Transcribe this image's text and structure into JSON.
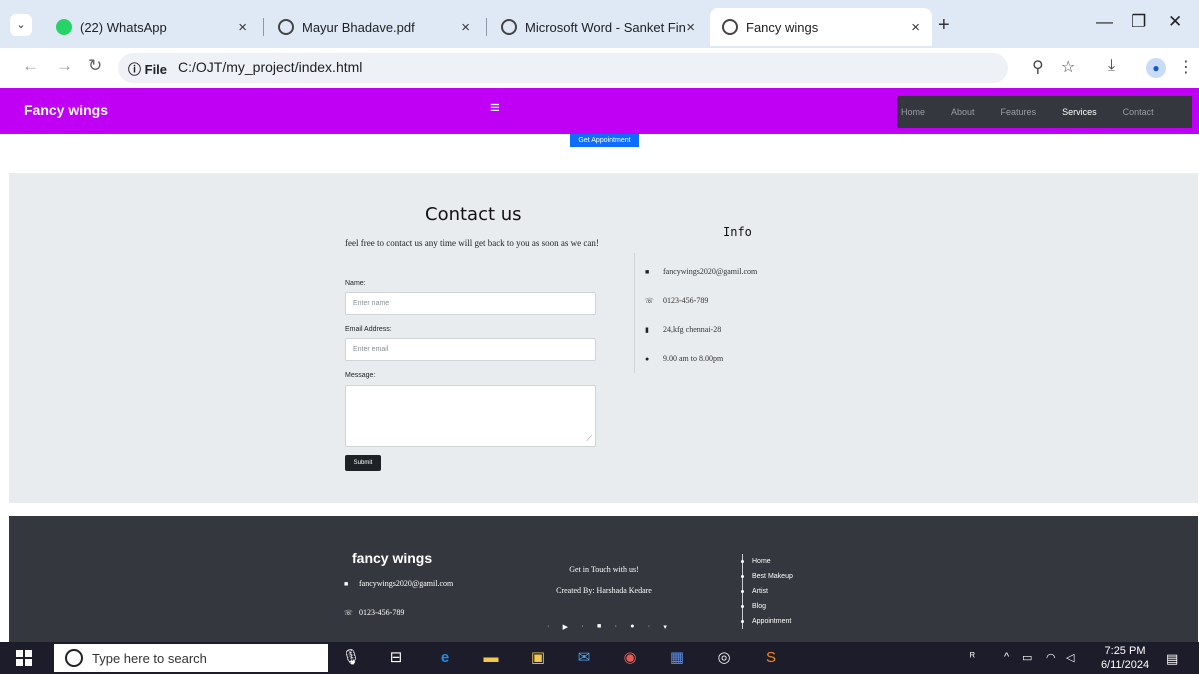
{
  "browser": {
    "tabs": [
      {
        "label": "(22) WhatsApp",
        "icon": "whatsapp-icon"
      },
      {
        "label": "Mayur Bhadave.pdf",
        "icon": "globe-icon"
      },
      {
        "label": "Microsoft Word - Sanket Final P",
        "icon": "globe-icon"
      },
      {
        "label": "Fancy wings",
        "icon": "globe-icon",
        "active": true
      }
    ],
    "address": {
      "info_label": "File",
      "url": "C:/OJT/my_project/index.html"
    }
  },
  "page": {
    "brand": "Fancy wings",
    "hamburger": "≡",
    "nav": [
      "Home",
      "About",
      "Features",
      "Services",
      "Contact"
    ],
    "active_nav": "Services",
    "appointment_button": "Get Appointment",
    "contact": {
      "title": "Contact us",
      "subtitle": "feel free to contact us any time will get back to you as soon as we can!",
      "name_label": "Name:",
      "name_placeholder": "Enter name",
      "email_label": "Email Address:",
      "email_placeholder": "Enter email",
      "message_label": "Message:",
      "submit_label": "Submit"
    },
    "info": {
      "title": "Info",
      "items": [
        {
          "icon": "envelope-icon",
          "text": "fancywings2020@gamil.com"
        },
        {
          "icon": "phone-icon",
          "text": "0123-456-789"
        },
        {
          "icon": "building-icon",
          "text": "24,kfg chennai-28"
        },
        {
          "icon": "clock-icon",
          "text": "9.00 am to 8.00pm"
        }
      ]
    },
    "footer": {
      "brand": "fancy wings",
      "email": "fancywings2020@gamil.com",
      "phone": "0123-456-789",
      "get_in_touch": "Get in Touch with us!",
      "created_by": "Created By: Harshada Kedare",
      "links": [
        "Home",
        "Best Makeup",
        "Artist",
        "Blog",
        "Appointment"
      ]
    }
  },
  "taskbar": {
    "search_placeholder": "Type here to search",
    "time": "7:25 PM",
    "date": "6/11/2024"
  },
  "colors": {
    "navbar": "#c000f5",
    "button_blue": "#0d6efd",
    "footer": "#34373d"
  }
}
